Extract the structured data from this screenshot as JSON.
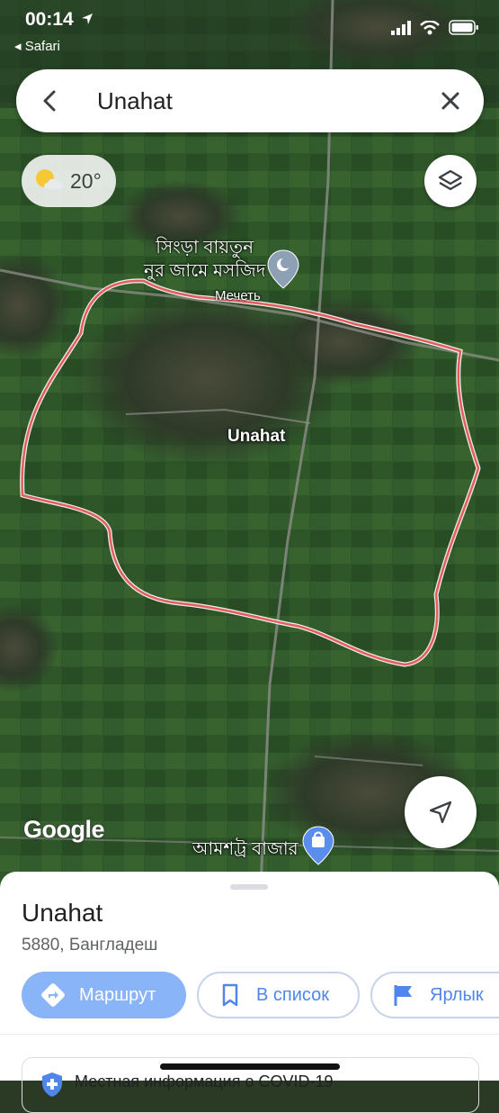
{
  "status_bar": {
    "time": "00:14",
    "back_app": "Safari"
  },
  "search": {
    "query": "Unahat"
  },
  "weather": {
    "temperature": "20°",
    "icon": "partly-cloudy-icon"
  },
  "map": {
    "labels": {
      "mosque_name_line1": "সিংড়া বায়তুন",
      "mosque_name_line2": "নুর জামে মসজিদ",
      "mosque_type": "Мечеть",
      "area_name": "Unahat",
      "bazar_name": "আমশট্র বাজার"
    },
    "attribution": "Google",
    "boundary_color": "#e35d5d"
  },
  "sheet": {
    "title": "Unahat",
    "subtitle": "5880, Бангладеш",
    "buttons": {
      "route": "Маршрут",
      "save": "В список",
      "label": "Ярлык"
    },
    "covid_text": "Местная информация о COVID-19"
  },
  "colors": {
    "accent": "#4f86ec",
    "route_button": "#8ab4f8"
  }
}
